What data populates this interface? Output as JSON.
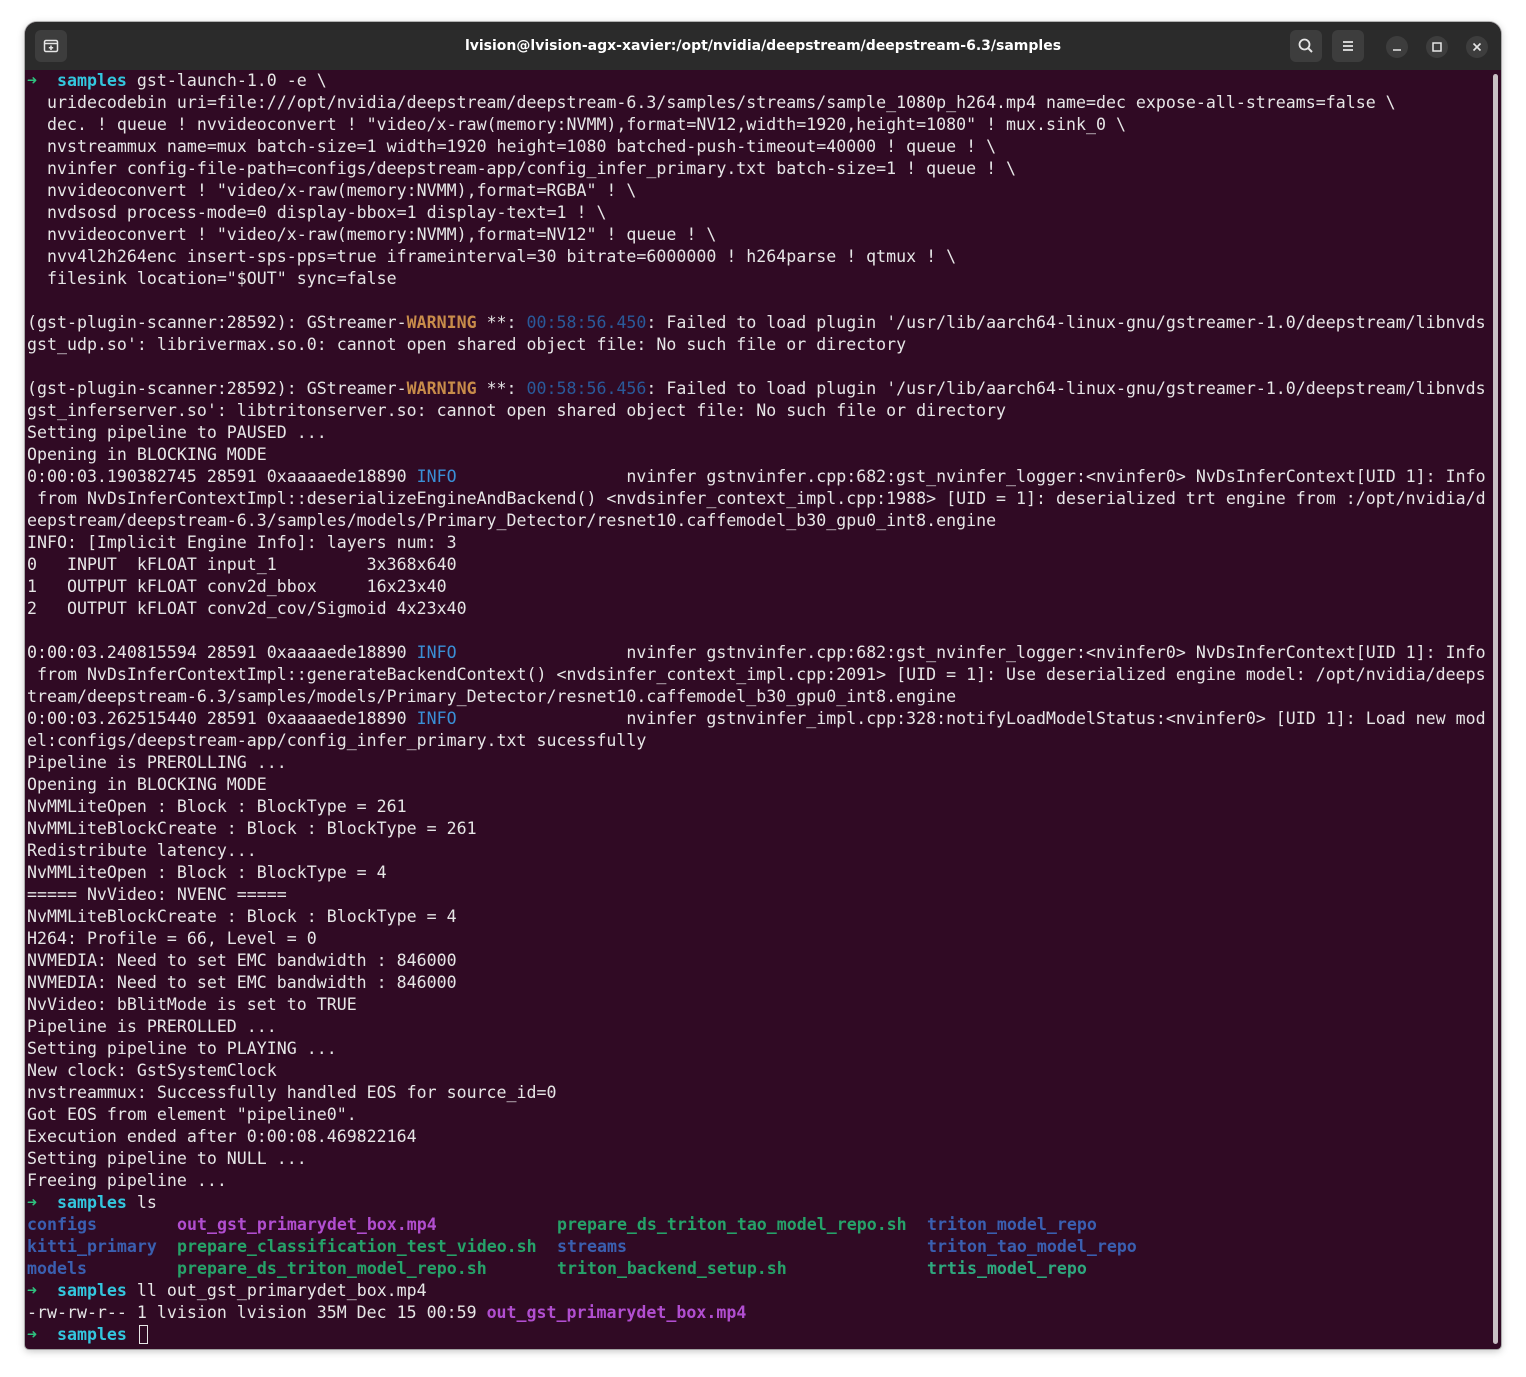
{
  "window": {
    "title": "lvision@lvision-agx-xavier:/opt/nvidia/deepstream/deepstream-6.3/samples"
  },
  "titlebar": {
    "new_tab_icon": "new-tab-icon",
    "search_icon": "search-icon",
    "menu_icon": "hamburger-menu-icon",
    "minimize_icon": "minimize-icon",
    "maximize_icon": "maximize-icon",
    "close_icon": "close-icon"
  },
  "colors": {
    "background": "#300a24",
    "prompt_arrow": "#2ec27e",
    "prompt_dir": "#33c7de",
    "warning": "#c88c4a",
    "info": "#3a8fd6",
    "dir_listing": "#3a5fb0",
    "mp4_listing": "#b14ed0",
    "script_listing": "#26a269"
  },
  "prompt": {
    "arrow": "➜",
    "dir": "samples"
  },
  "terminal": {
    "cmd1": "gst-launch-1.0 -e \\",
    "pipeline": [
      "  uridecodebin uri=file:///opt/nvidia/deepstream/deepstream-6.3/samples/streams/sample_1080p_h264.mp4 name=dec expose-all-streams=false \\",
      "  dec. ! queue ! nvvideoconvert ! \"video/x-raw(memory:NVMM),format=NV12,width=1920,height=1080\" ! mux.sink_0 \\",
      "  nvstreammux name=mux batch-size=1 width=1920 height=1080 batched-push-timeout=40000 ! queue ! \\",
      "  nvinfer config-file-path=configs/deepstream-app/config_infer_primary.txt batch-size=1 ! queue ! \\",
      "  nvvideoconvert ! \"video/x-raw(memory:NVMM),format=RGBA\" ! \\",
      "  nvdsosd process-mode=0 display-bbox=1 display-text=1 ! \\",
      "  nvvideoconvert ! \"video/x-raw(memory:NVMM),format=NV12\" ! queue ! \\",
      "  nvv4l2h264enc insert-sps-pps=true iframeinterval=30 bitrate=6000000 ! h264parse ! qtmux ! \\",
      "  filesink location=\"$OUT\" sync=false"
    ],
    "warn1": {
      "pre": "(gst-plugin-scanner:28592): GStreamer-",
      "level": "WARNING",
      "mid": " **: ",
      "time": "00:58:56.450",
      "post": ": Failed to load plugin '/usr/lib/aarch64-linux-gnu/gstreamer-1.0/deepstream/libnvds",
      "cont": "gst_udp.so': librivermax.so.0: cannot open shared object file: No such file or directory"
    },
    "warn2": {
      "pre": "(gst-plugin-scanner:28592): GStreamer-",
      "level": "WARNING",
      "mid": " **: ",
      "time": "00:58:56.456",
      "post": ": Failed to load plugin '/usr/lib/aarch64-linux-gnu/gstreamer-1.0/deepstream/libnvds",
      "cont": "gst_inferserver.so': libtritonserver.so: cannot open shared object file: No such file or directory"
    },
    "log_a": [
      "Setting pipeline to PAUSED ...",
      "Opening in BLOCKING MODE"
    ],
    "info1": {
      "pre": "0:00:03.190382745 28591 0xaaaaede18890 ",
      "level": "INFO",
      "post": "                 nvinfer gstnvinfer.cpp:682:gst_nvinfer_logger:<nvinfer0> NvDsInferContext[UID 1]: Info",
      "cont": [
        " from NvDsInferContextImpl::deserializeEngineAndBackend() <nvdsinfer_context_impl.cpp:1988> [UID = 1]: deserialized trt engine from :/opt/nvidia/d",
        "eepstream/deepstream-6.3/samples/models/Primary_Detector/resnet10.caffemodel_b30_gpu0_int8.engine"
      ]
    },
    "layers": [
      "INFO: [Implicit Engine Info]: layers num: 3",
      "0   INPUT  kFLOAT input_1         3x368x640",
      "1   OUTPUT kFLOAT conv2d_bbox     16x23x40",
      "2   OUTPUT kFLOAT conv2d_cov/Sigmoid 4x23x40"
    ],
    "info2": {
      "pre": "0:00:03.240815594 28591 0xaaaaede18890 ",
      "level": "INFO",
      "post": "                 nvinfer gstnvinfer.cpp:682:gst_nvinfer_logger:<nvinfer0> NvDsInferContext[UID 1]: Info",
      "cont": [
        " from NvDsInferContextImpl::generateBackendContext() <nvdsinfer_context_impl.cpp:2091> [UID = 1]: Use deserialized engine model: /opt/nvidia/deeps",
        "tream/deepstream-6.3/samples/models/Primary_Detector/resnet10.caffemodel_b30_gpu0_int8.engine"
      ]
    },
    "info3": {
      "pre": "0:00:03.262515440 28591 0xaaaaede18890 ",
      "level": "INFO",
      "post": "                 nvinfer gstnvinfer_impl.cpp:328:notifyLoadModelStatus:<nvinfer0> [UID 1]: Load new mod",
      "cont": [
        "el:configs/deepstream-app/config_infer_primary.txt sucessfully"
      ]
    },
    "log_b": [
      "Pipeline is PREROLLING ...",
      "Opening in BLOCKING MODE",
      "NvMMLiteOpen : Block : BlockType = 261",
      "NvMMLiteBlockCreate : Block : BlockType = 261",
      "Redistribute latency...",
      "NvMMLiteOpen : Block : BlockType = 4",
      "===== NvVideo: NVENC =====",
      "NvMMLiteBlockCreate : Block : BlockType = 4",
      "H264: Profile = 66, Level = 0",
      "NVMEDIA: Need to set EMC bandwidth : 846000",
      "NVMEDIA: Need to set EMC bandwidth : 846000",
      "NvVideo: bBlitMode is set to TRUE",
      "Pipeline is PREROLLED ...",
      "Setting pipeline to PLAYING ...",
      "New clock: GstSystemClock",
      "nvstreammux: Successfully handled EOS for source_id=0",
      "Got EOS from element \"pipeline0\".",
      "Execution ended after 0:00:08.469822164",
      "Setting pipeline to NULL ...",
      "Freeing pipeline ..."
    ],
    "cmd2": "ls",
    "ls": {
      "col1": [
        "configs",
        "kitti_primary",
        "models"
      ],
      "col2": [
        "out_gst_primarydet_box.mp4",
        "prepare_classification_test_video.sh",
        "prepare_ds_triton_model_repo.sh"
      ],
      "col3": [
        "prepare_ds_triton_tao_model_repo.sh",
        "streams",
        "triton_backend_setup.sh"
      ],
      "col4": [
        "triton_model_repo",
        "triton_tao_model_repo",
        "trtis_model_repo"
      ]
    },
    "cmd3": "ll out_gst_primarydet_box.mp4",
    "ll_line": {
      "meta": "-rw-rw-r-- 1 lvision lvision 35M Dec 15 00:59 ",
      "file": "out_gst_primarydet_box.mp4"
    }
  }
}
